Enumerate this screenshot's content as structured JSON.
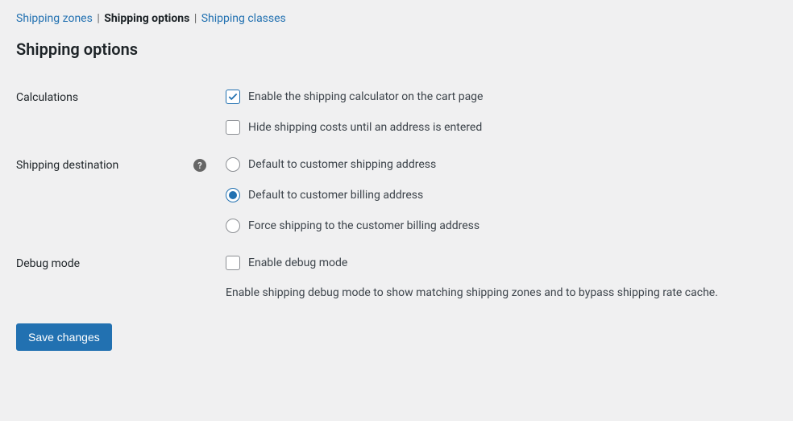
{
  "tabs": {
    "zones": "Shipping zones",
    "options": "Shipping options",
    "classes": "Shipping classes"
  },
  "heading": "Shipping options",
  "sections": {
    "calculations": {
      "label": "Calculations",
      "enable_calculator": "Enable the shipping calculator on the cart page",
      "hide_costs": "Hide shipping costs until an address is entered"
    },
    "destination": {
      "label": "Shipping destination",
      "opt_shipping": "Default to customer shipping address",
      "opt_billing": "Default to customer billing address",
      "opt_force": "Force shipping to the customer billing address"
    },
    "debug": {
      "label": "Debug mode",
      "enable": "Enable debug mode",
      "description": "Enable shipping debug mode to show matching shipping zones and to bypass shipping rate cache."
    }
  },
  "buttons": {
    "save": "Save changes"
  }
}
